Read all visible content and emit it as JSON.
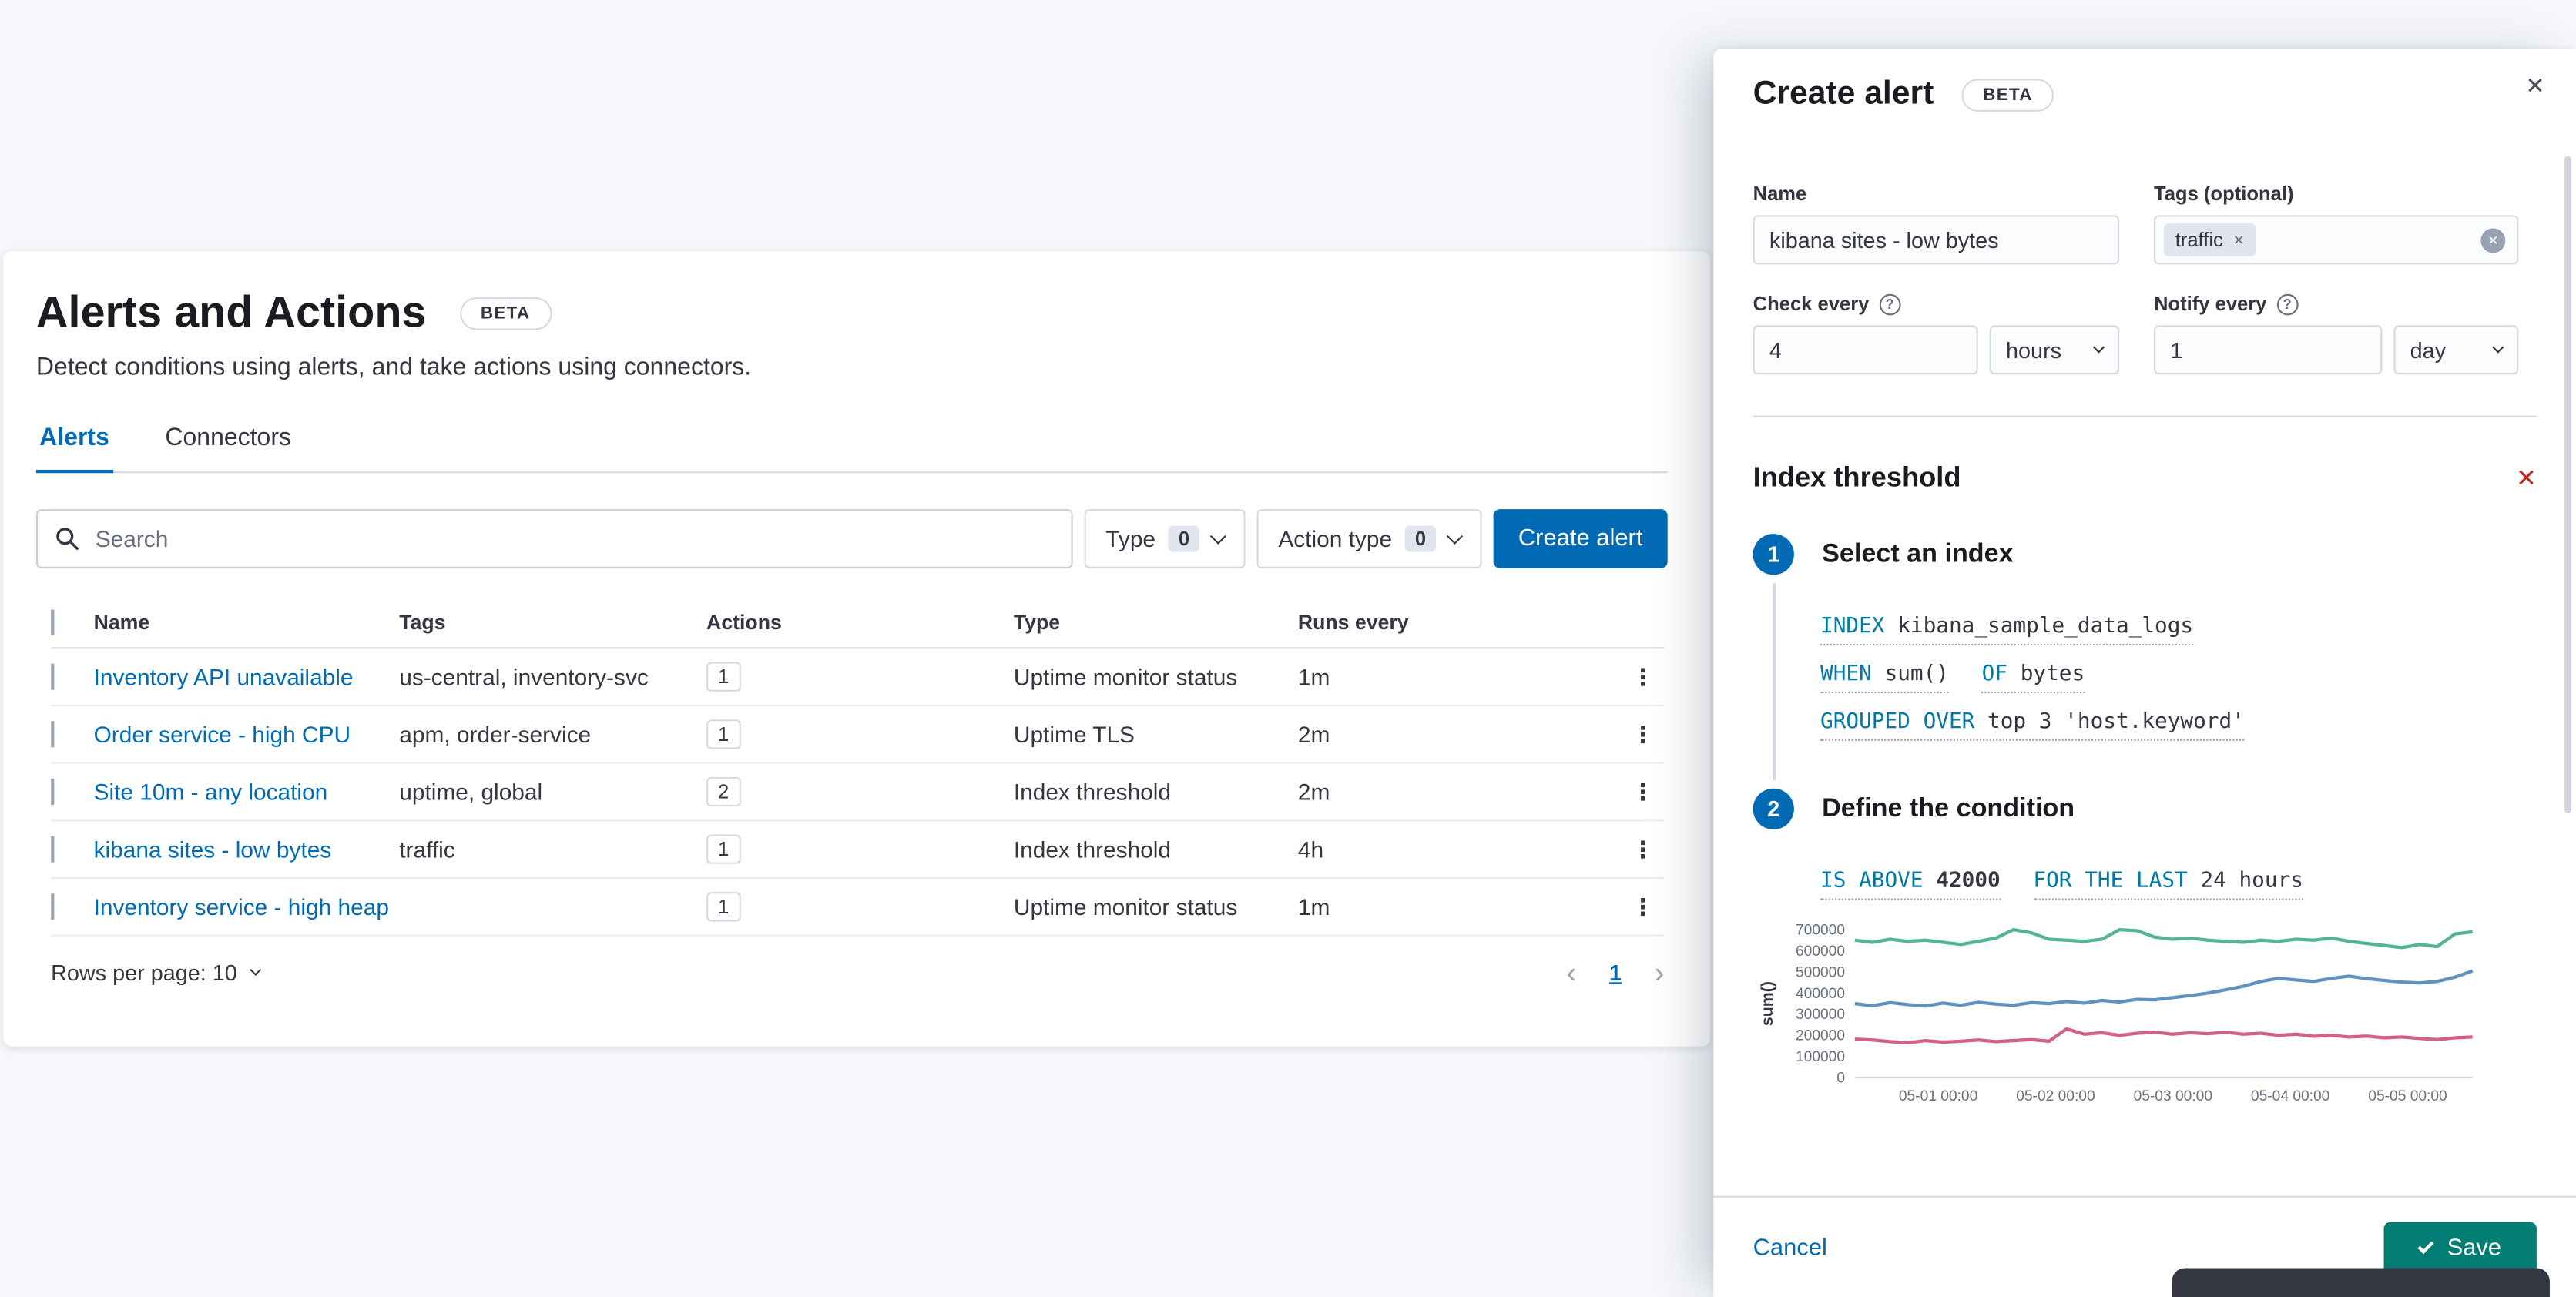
{
  "icons": {
    "close": "✕",
    "remove": "✕",
    "clear": "✕",
    "pill_remove": "✕",
    "question": "?",
    "kebab": "⋮",
    "prev": "‹",
    "next": "›"
  },
  "page": {
    "header": {
      "title": "Alerts and Actions",
      "beta": "BETA",
      "subtitle": "Detect conditions using alerts, and take actions using connectors."
    },
    "tabs": [
      {
        "label": "Alerts",
        "active": true
      },
      {
        "label": "Connectors",
        "active": false
      }
    ],
    "toolbar": {
      "search_placeholder": "Search",
      "filters": [
        {
          "label": "Type",
          "count": "0"
        },
        {
          "label": "Action type",
          "count": "0"
        }
      ],
      "create_button": "Create alert"
    },
    "table": {
      "columns": [
        "Name",
        "Tags",
        "Actions",
        "Type",
        "Runs every"
      ],
      "rows": [
        {
          "name": "Inventory API unavailable",
          "tags": "us-central, inventory-svc",
          "actions": "1",
          "type": "Uptime monitor status",
          "runs_every": "1m"
        },
        {
          "name": "Order service - high CPU",
          "tags": "apm, order-service",
          "actions": "1",
          "type": "Uptime TLS",
          "runs_every": "2m"
        },
        {
          "name": "Site 10m - any location",
          "tags": "uptime, global",
          "actions": "2",
          "type": "Index threshold",
          "runs_every": "2m"
        },
        {
          "name": "kibana sites - low bytes",
          "tags": "traffic",
          "actions": "1",
          "type": "Index threshold",
          "runs_every": "4h"
        },
        {
          "name": "Inventory service - high heap",
          "tags": "",
          "actions": "1",
          "type": "Uptime monitor status",
          "runs_every": "1m"
        }
      ]
    },
    "pagination": {
      "rows_per_page": "Rows per page: 10",
      "page": "1"
    }
  },
  "flyout": {
    "title": "Create alert",
    "beta": "BETA",
    "fields": {
      "name_label": "Name",
      "name_value": "kibana sites - low bytes",
      "tags_label": "Tags (optional)",
      "tags_pill": "traffic",
      "check_label": "Check every",
      "check_value": "4",
      "check_unit": "hours",
      "notify_label": "Notify every",
      "notify_value": "1",
      "notify_unit": "day"
    },
    "alert_type": {
      "title": "Index threshold",
      "steps": [
        {
          "number": "1",
          "title": "Select an index"
        },
        {
          "number": "2",
          "title": "Define the condition"
        }
      ],
      "expressions": {
        "index_kw": "INDEX",
        "index_val": "kibana_sample_data_logs",
        "when_kw": "WHEN",
        "when_val": "sum()",
        "of_kw": "OF",
        "of_val": "bytes",
        "grouped_kw": "GROUPED OVER",
        "grouped_val": "top 3 'host.keyword'",
        "above_kw": "IS ABOVE",
        "above_val": "42000",
        "last_kw": "FOR THE LAST",
        "last_val": "24 hours"
      }
    },
    "footer": {
      "cancel": "Cancel",
      "save": "Save"
    }
  },
  "chart_data": {
    "type": "line",
    "title": "",
    "xlabel": "",
    "ylabel": "sum()",
    "ylim": [
      0,
      700000
    ],
    "grid": false,
    "legend": false,
    "yticks": [
      700000,
      600000,
      500000,
      400000,
      300000,
      200000,
      100000,
      0
    ],
    "xticks": [
      {
        "label": "05-01 00:00",
        "pos": 0.135
      },
      {
        "label": "05-02 00:00",
        "pos": 0.325
      },
      {
        "label": "05-03 00:00",
        "pos": 0.515
      },
      {
        "label": "05-04 00:00",
        "pos": 0.705
      },
      {
        "label": "05-05 00:00",
        "pos": 0.895
      }
    ],
    "series": [
      {
        "color": "#54B399",
        "values": [
          650000,
          640000,
          655000,
          645000,
          650000,
          640000,
          630000,
          645000,
          660000,
          700000,
          685000,
          655000,
          650000,
          645000,
          655000,
          700000,
          695000,
          665000,
          655000,
          660000,
          650000,
          645000,
          640000,
          650000,
          645000,
          655000,
          650000,
          660000,
          645000,
          635000,
          625000,
          615000,
          630000,
          620000,
          680000,
          690000
        ]
      },
      {
        "color": "#6092C0",
        "values": [
          350000,
          340000,
          355000,
          345000,
          338000,
          352000,
          342000,
          356000,
          348000,
          342000,
          355000,
          350000,
          360000,
          352000,
          365000,
          358000,
          370000,
          368000,
          378000,
          388000,
          400000,
          415000,
          432000,
          455000,
          470000,
          462000,
          455000,
          470000,
          480000,
          468000,
          460000,
          452000,
          448000,
          455000,
          475000,
          505000
        ]
      },
      {
        "color": "#D36086",
        "values": [
          182000,
          178000,
          170000,
          165000,
          175000,
          168000,
          172000,
          178000,
          170000,
          175000,
          180000,
          172000,
          230000,
          205000,
          212000,
          200000,
          210000,
          215000,
          205000,
          212000,
          208000,
          215000,
          205000,
          210000,
          200000,
          205000,
          195000,
          200000,
          192000,
          196000,
          188000,
          192000,
          185000,
          180000,
          188000,
          192000
        ]
      }
    ]
  }
}
